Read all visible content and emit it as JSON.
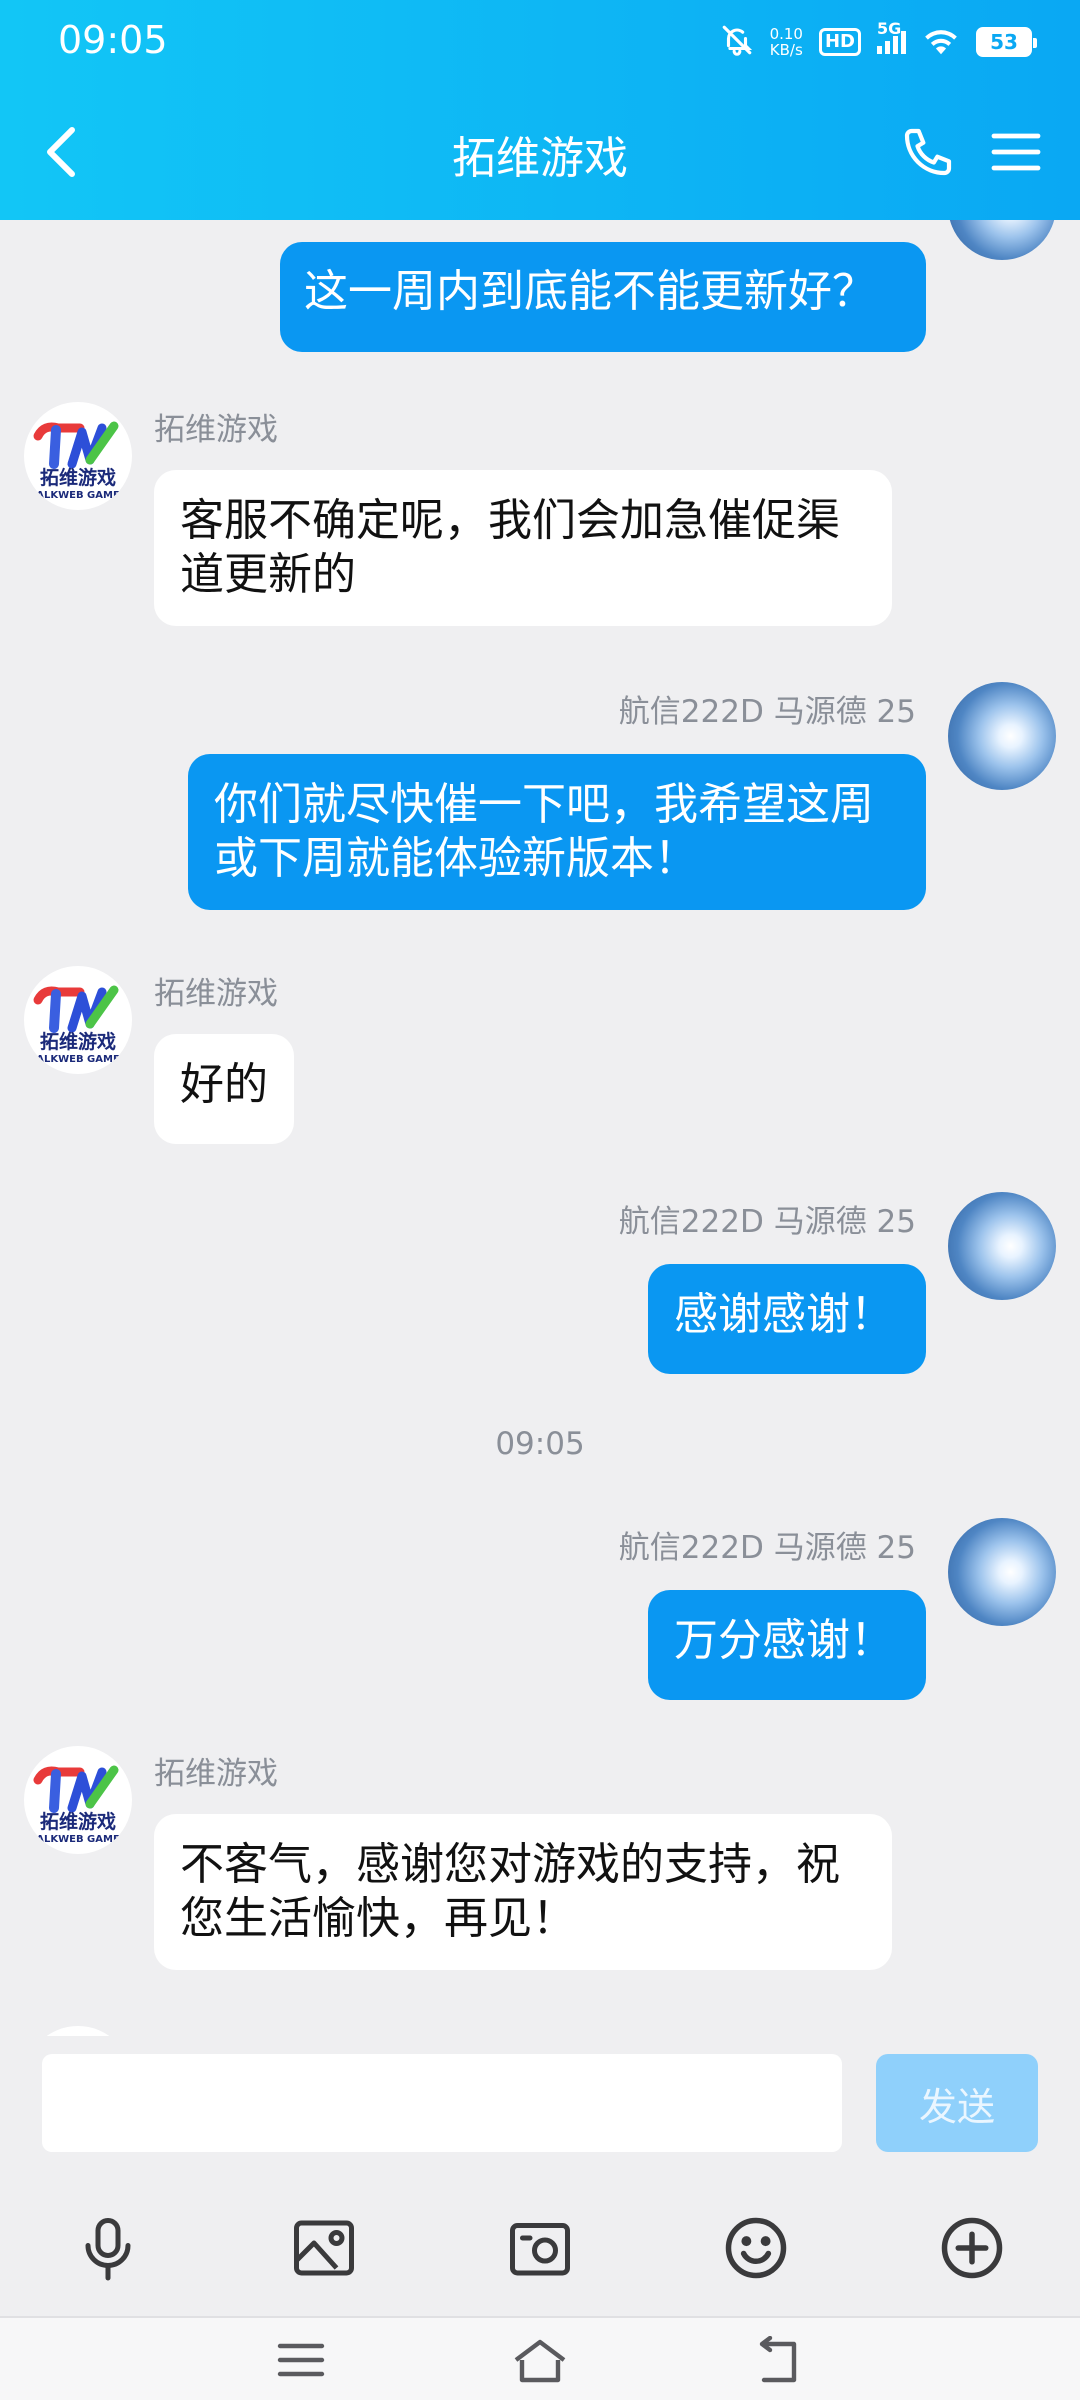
{
  "status": {
    "time": "09:05",
    "net_speed_value": "0.10",
    "net_speed_unit": "KB/s",
    "hd": "HD",
    "network": "5G",
    "battery": "53"
  },
  "header": {
    "title": "拓维游戏"
  },
  "logo": {
    "text": "拓维游戏",
    "subtext": "ALKWEB GAME"
  },
  "messages": [
    {
      "text": "这一周内到底能不能更新好？"
    },
    {
      "sender": "拓维游戏",
      "text": "客服不确定呢，我们会加急催促渠道更新的"
    },
    {
      "sender": "航信222D 马源德 25",
      "text": "你们就尽快催一下吧，我希望这周或下周就能体验新版本！"
    },
    {
      "sender": "拓维游戏",
      "text": "好的"
    },
    {
      "sender": "航信222D 马源德 25",
      "text": "感谢感谢！"
    },
    {
      "time": "09:05"
    },
    {
      "sender": "航信222D 马源德 25",
      "text": "万分感谢！"
    },
    {
      "sender": "拓维游戏",
      "text": "不客气，感谢您对游戏的支持，祝您生活愉快，再见！"
    }
  ],
  "input": {
    "placeholder": "",
    "send_label": "发送"
  },
  "toolbar": [
    "microphone-icon",
    "image-icon",
    "camera-icon",
    "emoji-icon",
    "plus-icon"
  ],
  "colors": {
    "header": "#0aa8f3",
    "out_bubble": "#0a97f2",
    "in_bubble": "#ffffff",
    "send_disabled": "#8fd0fb"
  }
}
